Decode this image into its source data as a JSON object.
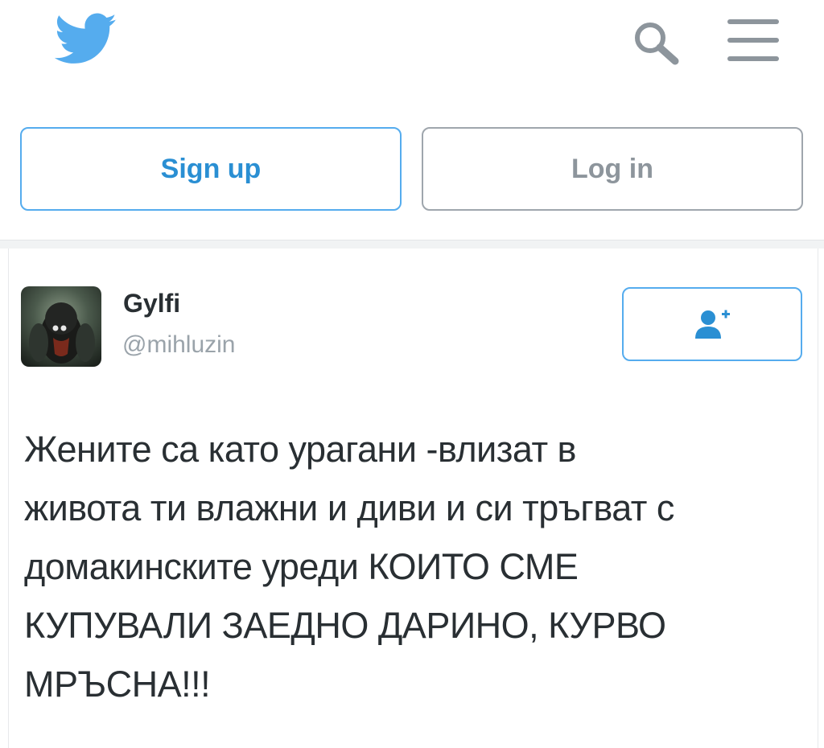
{
  "header": {
    "logo_icon": "twitter-bird-icon",
    "search_icon": "search-icon",
    "menu_icon": "hamburger-menu-icon",
    "brand_color": "#55acee"
  },
  "auth": {
    "signup_label": "Sign up",
    "login_label": "Log in"
  },
  "tweet": {
    "author_name": "Gylfi",
    "author_handle": "@mihluzin",
    "follow_icon": "add-user-icon",
    "lines": [
      "Жените са като урагани -влизат в",
      "живота ти влажни и диви и си тръгват с",
      "домакинските уреди КОИТО СМЕ",
      "КУПУВАЛИ ЗАЕДНО ДАРИНО, КУРВО",
      "МРЪСНА!!!"
    ]
  }
}
